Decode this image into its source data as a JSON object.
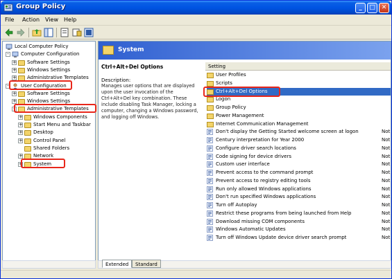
{
  "window": {
    "title": "Group Policy"
  },
  "menu": [
    "File",
    "Action",
    "View",
    "Help"
  ],
  "tree": [
    {
      "label": "Local Computer Policy",
      "level": 0,
      "expander": "",
      "icon": "computer"
    },
    {
      "label": "Computer Configuration",
      "level": 1,
      "expander": "-",
      "icon": "computer"
    },
    {
      "label": "Software Settings",
      "level": 2,
      "expander": "+",
      "icon": "folder"
    },
    {
      "label": "Windows Settings",
      "level": 2,
      "expander": "+",
      "icon": "folder"
    },
    {
      "label": "Administrative Templates",
      "level": 2,
      "expander": "+",
      "icon": "folder"
    },
    {
      "label": "User Configuration",
      "level": 1,
      "expander": "-",
      "icon": "user"
    },
    {
      "label": "Software Settings",
      "level": 2,
      "expander": "+",
      "icon": "folder"
    },
    {
      "label": "Windows Settings",
      "level": 2,
      "expander": "+",
      "icon": "folder"
    },
    {
      "label": "Administrative Templates",
      "level": 2,
      "expander": "-",
      "icon": "folder"
    },
    {
      "label": "Windows Components",
      "level": 3,
      "expander": "+",
      "icon": "folder"
    },
    {
      "label": "Start Menu and Taskbar",
      "level": 3,
      "expander": "+",
      "icon": "folder"
    },
    {
      "label": "Desktop",
      "level": 3,
      "expander": "+",
      "icon": "folder"
    },
    {
      "label": "Control Panel",
      "level": 3,
      "expander": "+",
      "icon": "folder"
    },
    {
      "label": "Shared Folders",
      "level": 3,
      "expander": "",
      "icon": "folder"
    },
    {
      "label": "Network",
      "level": 3,
      "expander": "+",
      "icon": "folder"
    },
    {
      "label": "System",
      "level": 3,
      "expander": "+",
      "icon": "folder"
    }
  ],
  "header": {
    "title": "System"
  },
  "description": {
    "heading": "Ctrl+Alt+Del Options",
    "label": "Description:",
    "body": "Manages user options that are displayed upon the user invocation of the Ctrl+Alt+Del key combination. These include disabling Task Manager, locking a computer, changing a Windows password, and logging off Windows."
  },
  "list": {
    "column_header": "Setting",
    "rows": [
      {
        "label": "User Profiles",
        "kind": "folder",
        "state": ""
      },
      {
        "label": "Scripts",
        "kind": "folder",
        "state": ""
      },
      {
        "label": "Ctrl+Alt+Del Options",
        "kind": "folder",
        "state": "",
        "selected": true
      },
      {
        "label": "Logon",
        "kind": "folder",
        "state": ""
      },
      {
        "label": "Group Policy",
        "kind": "folder",
        "state": ""
      },
      {
        "label": "Power Management",
        "kind": "folder",
        "state": ""
      },
      {
        "label": "Internet Communication Management",
        "kind": "folder",
        "state": ""
      },
      {
        "label": "Don't display the Getting Started welcome screen at logon",
        "kind": "policy",
        "state": "Not"
      },
      {
        "label": "Century interpretation for Year 2000",
        "kind": "policy",
        "state": "Not"
      },
      {
        "label": "Configure driver search locations",
        "kind": "policy",
        "state": "Not"
      },
      {
        "label": "Code signing for device drivers",
        "kind": "policy",
        "state": "Not"
      },
      {
        "label": "Custom user interface",
        "kind": "policy",
        "state": "Not"
      },
      {
        "label": "Prevent access to the command prompt",
        "kind": "policy",
        "state": "Not"
      },
      {
        "label": "Prevent access to registry editing tools",
        "kind": "policy",
        "state": "Not"
      },
      {
        "label": "Run only allowed Windows applications",
        "kind": "policy",
        "state": "Not"
      },
      {
        "label": "Don't run specified Windows applications",
        "kind": "policy",
        "state": "Not"
      },
      {
        "label": "Turn off Autoplay",
        "kind": "policy",
        "state": "Not"
      },
      {
        "label": "Restrict these programs from being launched from Help",
        "kind": "policy",
        "state": "Not"
      },
      {
        "label": "Download missing COM components",
        "kind": "policy",
        "state": "Not"
      },
      {
        "label": "Windows Automatic Updates",
        "kind": "policy",
        "state": "Not"
      },
      {
        "label": "Turn off Windows Update device driver search prompt",
        "kind": "policy",
        "state": "Not"
      }
    ]
  },
  "tabs": [
    "Extended",
    "Standard"
  ],
  "colors": {
    "highlight": "#e8261a",
    "selection": "#316ac5",
    "title_bar": "#0054e3"
  }
}
